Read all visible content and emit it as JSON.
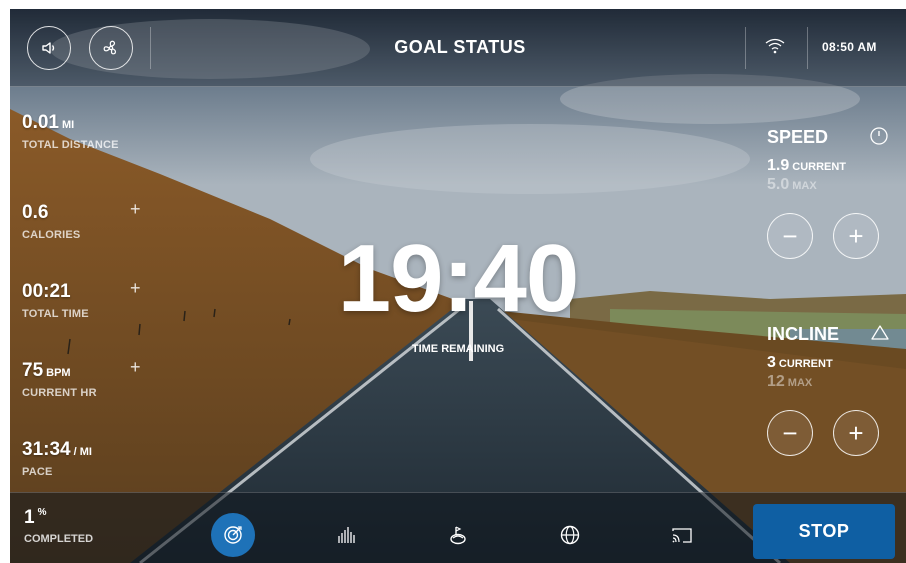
{
  "header": {
    "title": "GOAL STATUS",
    "time": "08:50 AM",
    "icons": [
      "speaker-icon",
      "fan-icon",
      "wifi-icon"
    ]
  },
  "stats": [
    {
      "value": "0.01",
      "unit": "MI",
      "label": "TOTAL DISTANCE"
    },
    {
      "value": "0.6",
      "unit": "",
      "label": "CALORIES"
    },
    {
      "value": "00:21",
      "unit": "",
      "label": "TOTAL TIME"
    },
    {
      "value": "75",
      "unit": "BPM",
      "label": "CURRENT HR"
    },
    {
      "value": "31:34",
      "unit": "/ MI",
      "label": "PACE"
    }
  ],
  "plus_symbol": "+",
  "center": {
    "time": "19:40",
    "label": "TIME REMAINING"
  },
  "speed": {
    "title": "SPEED",
    "current": "1.9",
    "current_label": "CURRENT",
    "max": "5.0",
    "max_label": "MAX",
    "minus": "−",
    "plus": "+"
  },
  "incline": {
    "title": "INCLINE",
    "current": "3",
    "current_label": "CURRENT",
    "max": "12",
    "max_label": "MAX",
    "minus": "−",
    "plus": "+"
  },
  "footer": {
    "completed_value": "1",
    "completed_unit": "%",
    "completed_label": "COMPLETED",
    "nav_icons": [
      "target-icon",
      "stats-bars-icon",
      "coach-icon",
      "globe-icon",
      "cast-icon"
    ],
    "stop_label": "STOP",
    "accent": "#1e72b8",
    "stop_color": "#0f5fa3"
  }
}
